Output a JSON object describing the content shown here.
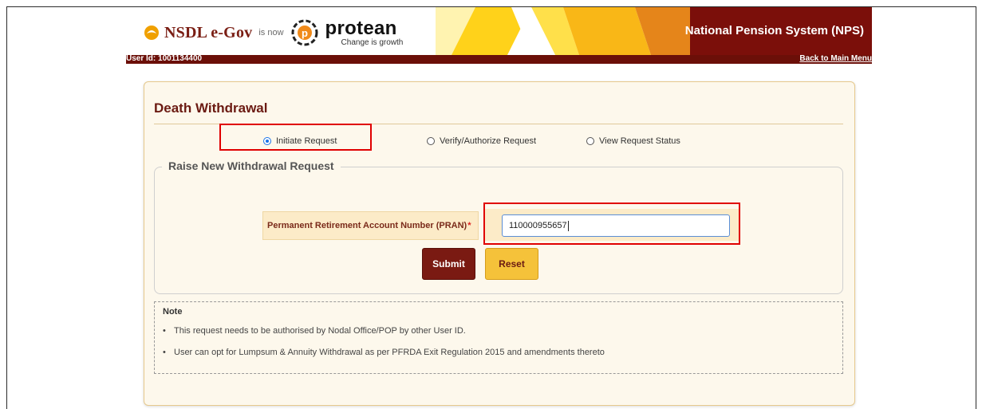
{
  "header": {
    "nsdl_logo": "NSDL e-Gov",
    "is_now": "is now",
    "protean_logo": "protean",
    "protean_tagline": "Change is growth",
    "title": "National Pension System (NPS)",
    "user_id": "User Id: 1001134400",
    "back_link": "Back to Main Menu"
  },
  "panel": {
    "title": "Death Withdrawal",
    "radio_options": [
      {
        "label": "Initiate Request",
        "selected": true
      },
      {
        "label": "Verify/Authorize Request",
        "selected": false
      },
      {
        "label": "View Request Status",
        "selected": false
      }
    ]
  },
  "form": {
    "legend": "Raise New Withdrawal Request",
    "pran_label": "Permanent Retirement Account Number (PRAN)",
    "required_mark": "*",
    "pran_value": "110000955657",
    "submit_label": "Submit",
    "reset_label": "Reset"
  },
  "note": {
    "title": "Note",
    "items": [
      "This request needs to be authorised by Nodal Office/POP by other User ID.",
      "User can opt for Lumpsum & Annuity Withdrawal as per PFRDA Exit Regulation 2015 and amendments thereto"
    ]
  },
  "colors": {
    "brand_maroon": "#7a1a12",
    "accent_yellow": "#f5c23a",
    "highlight_red": "#e00000",
    "panel_bg": "#fdf8ec"
  }
}
